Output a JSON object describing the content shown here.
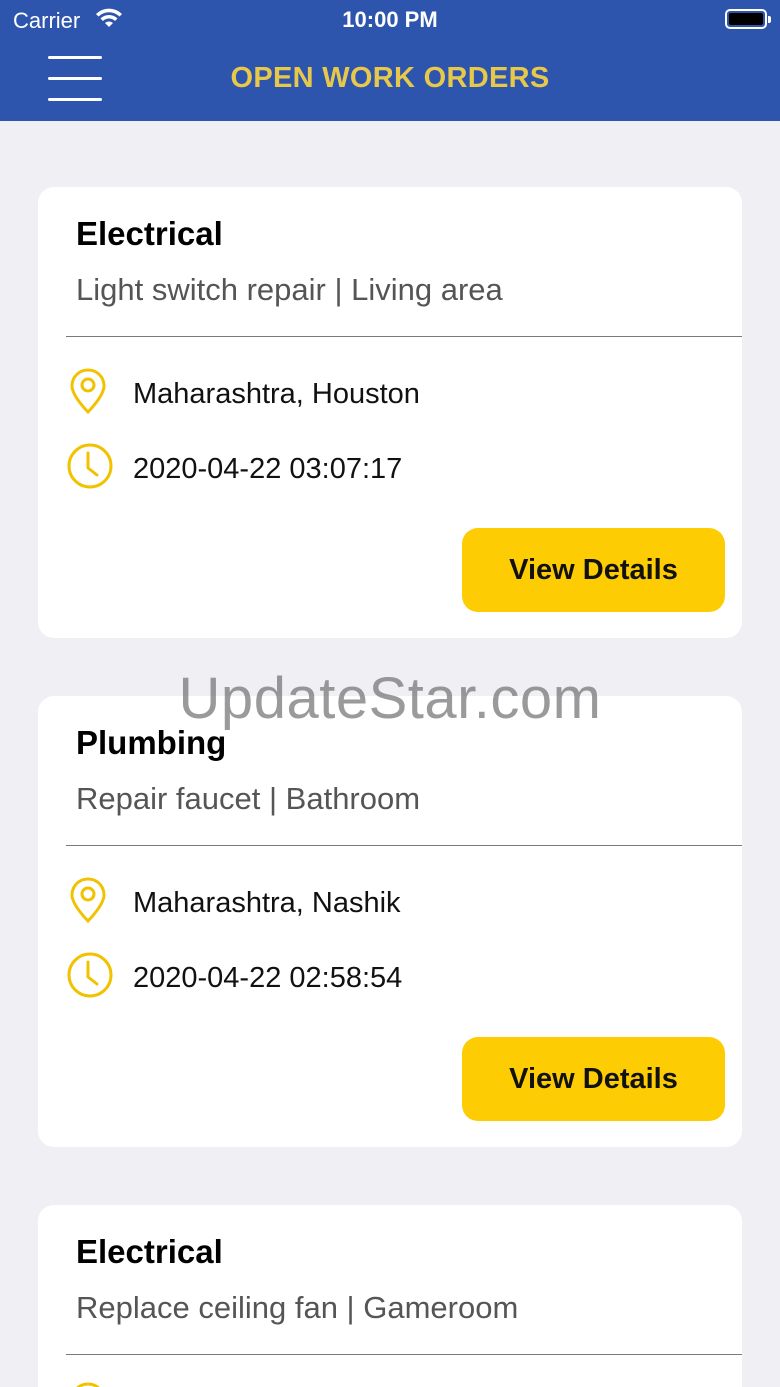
{
  "status_bar": {
    "carrier": "Carrier",
    "time": "10:00 PM"
  },
  "header": {
    "title": "OPEN WORK ORDERS",
    "menu_icon": "hamburger-menu-icon"
  },
  "orders": [
    {
      "category": "Electrical",
      "description": "Light switch repair | Living area",
      "location": "Maharashtra, Houston",
      "datetime": "2020-04-22 03:07:17",
      "button_label": "View Details"
    },
    {
      "category": "Plumbing",
      "description": "Repair faucet | Bathroom",
      "location": "Maharashtra, Nashik",
      "datetime": "2020-04-22 02:58:54",
      "button_label": "View Details"
    },
    {
      "category": "Electrical",
      "description": "Replace ceiling fan | Gameroom"
    }
  ],
  "watermark": "UpdateStar.com",
  "colors": {
    "header_bg": "#2d55ad",
    "title": "#e8c84a",
    "accent_button": "#fdcc02",
    "icon": "#f2c200",
    "page_bg": "#efeff4"
  }
}
